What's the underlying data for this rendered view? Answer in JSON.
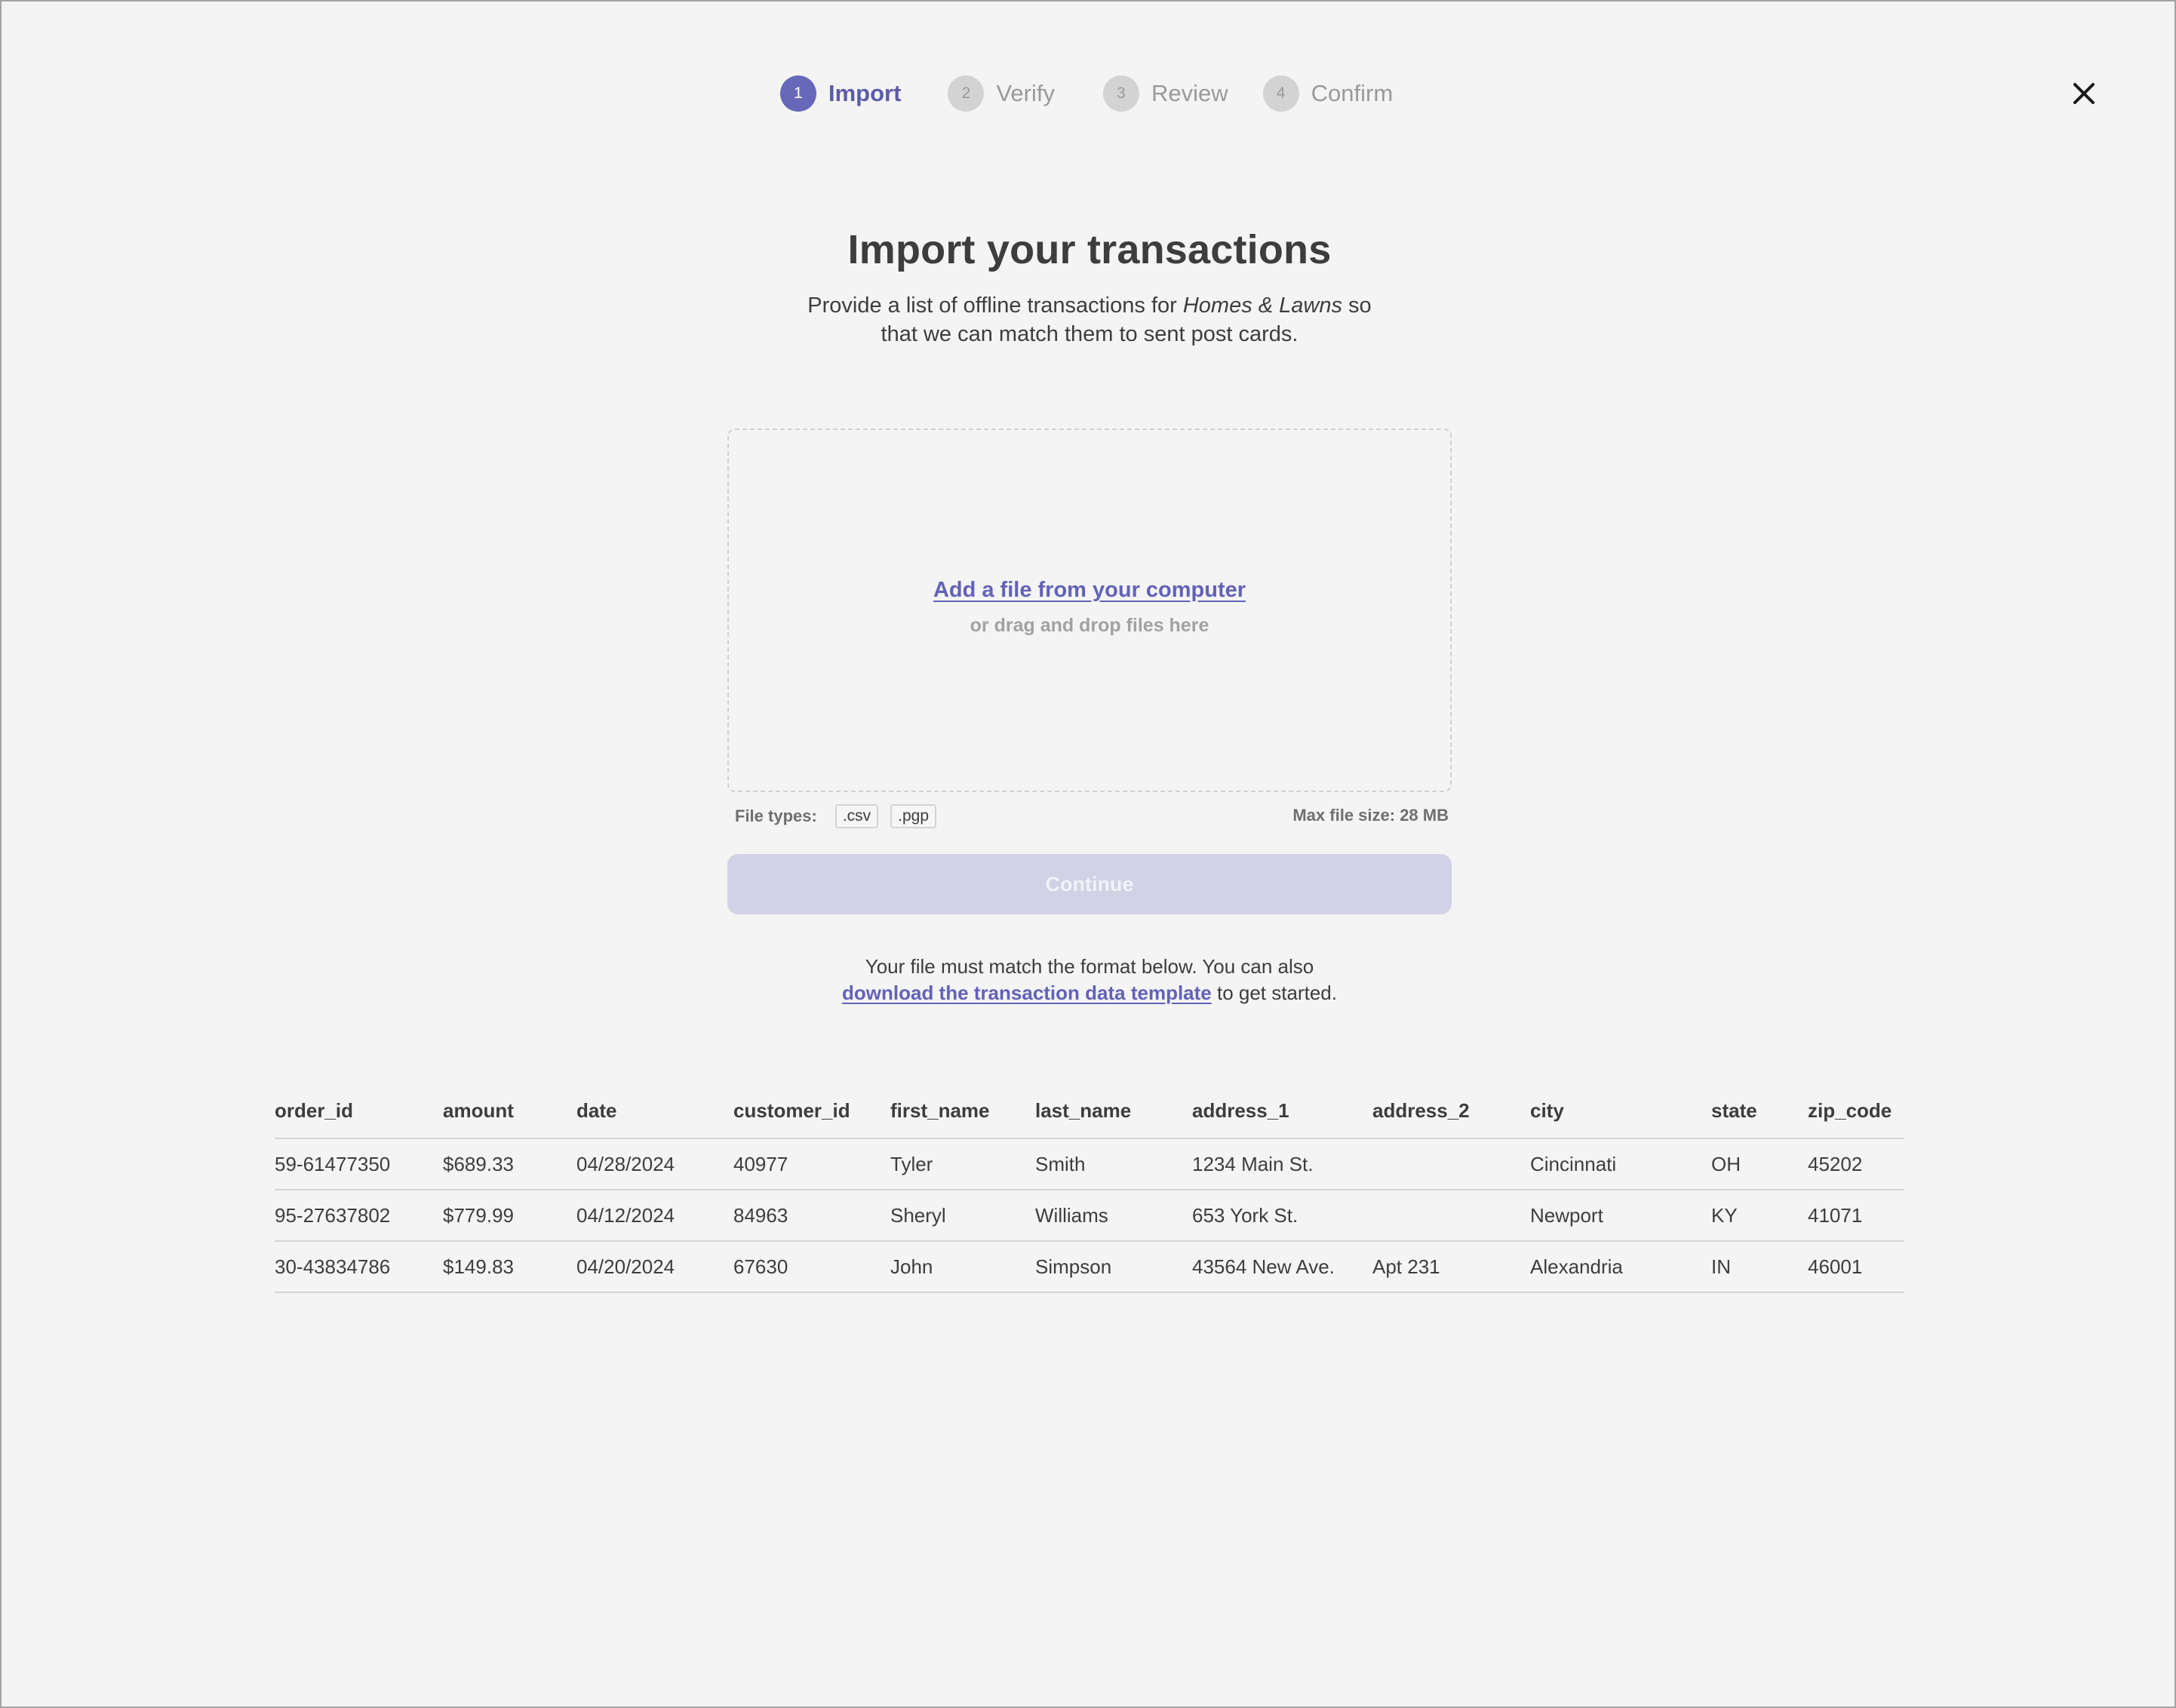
{
  "stepper": {
    "steps": [
      {
        "number": "1",
        "label": "Import",
        "state": "active"
      },
      {
        "number": "2",
        "label": "Verify",
        "state": "inactive"
      },
      {
        "number": "3",
        "label": "Review",
        "state": "inactive"
      },
      {
        "number": "4",
        "label": "Confirm",
        "state": "inactive"
      }
    ]
  },
  "close_icon": "close-icon",
  "header": {
    "title": "Import your transactions",
    "subtitle_pre": "Provide a list of offline transactions for ",
    "subtitle_brand": "Homes & Lawns",
    "subtitle_post": " so",
    "subtitle_line2": "that we can match them to sent post cards."
  },
  "dropzone": {
    "link_label": "Add a file from your computer",
    "sub_label": "or drag and drop files here"
  },
  "file_info": {
    "types_label": "File types:",
    "types": [
      ".csv",
      ".pgp"
    ],
    "max_size": "Max file size: 28 MB"
  },
  "continue_button": {
    "label": "Continue",
    "disabled": true
  },
  "format_note": {
    "line1": "Your file must match  the format below. You can also",
    "link": "download the transaction data template",
    "line2_post": " to get started."
  },
  "table": {
    "columns": [
      "order_id",
      "amount",
      "date",
      "customer_id",
      "first_name",
      "last_name",
      "address_1",
      "address_2",
      "city",
      "state",
      "zip_code"
    ],
    "rows": [
      [
        "59-61477350",
        "$689.33",
        "04/28/2024",
        "40977",
        "Tyler",
        "Smith",
        "1234 Main St.",
        "",
        "Cincinnati",
        "OH",
        "45202"
      ],
      [
        "95-27637802",
        "$779.99",
        "04/12/2024",
        "84963",
        "Sheryl",
        "Williams",
        "653 York St.",
        "",
        "Newport",
        "KY",
        "41071"
      ],
      [
        "30-43834786",
        "$149.83",
        "04/20/2024",
        "67630",
        "John",
        "Simpson",
        "43564 New Ave.",
        "Apt 231",
        "Alexandria",
        "IN",
        "46001"
      ]
    ]
  },
  "colors": {
    "accent": "#6868bb",
    "link": "#6262b8",
    "background": "#f4f4f4",
    "text": "#3d3d3d",
    "muted": "#9a9a9a",
    "button_disabled": "#d2d2e6"
  }
}
